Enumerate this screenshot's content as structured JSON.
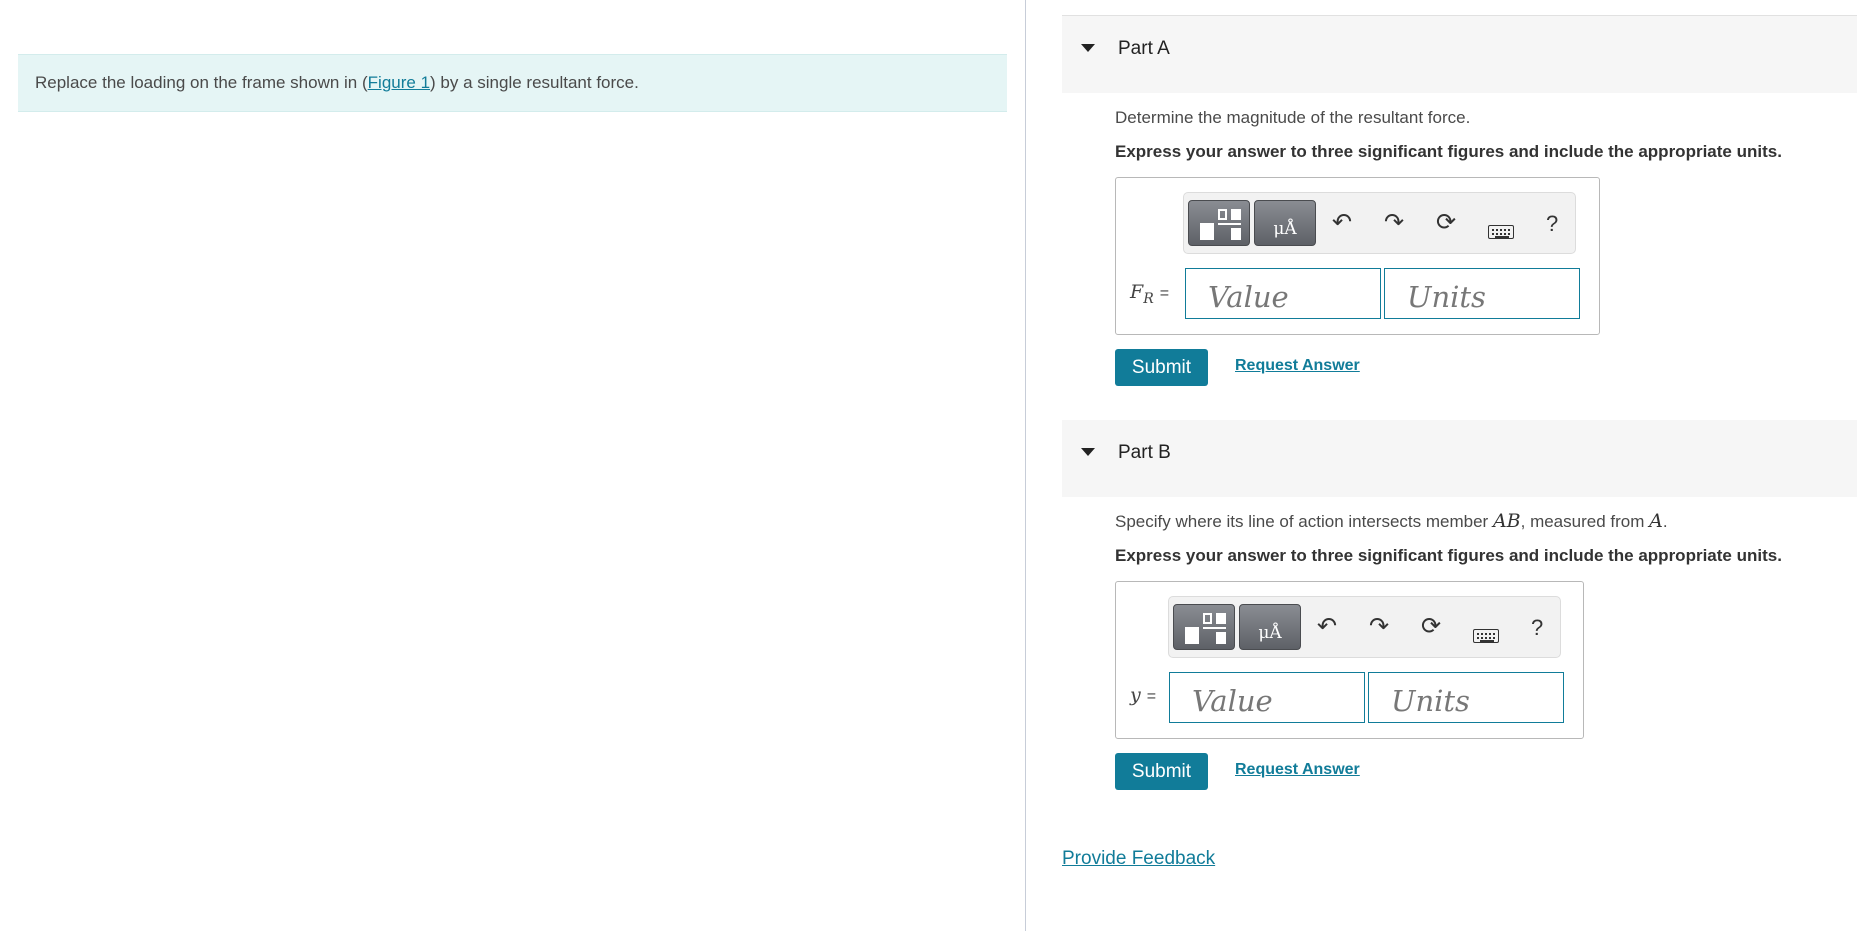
{
  "intro": {
    "prefix": "Replace the loading on the frame shown in (",
    "figure_link": "Figure 1",
    "suffix": ") by a single resultant force."
  },
  "parts": [
    {
      "title": "Part A",
      "prompt": "Determine the magnitude of the resultant force.",
      "instruction": "Express your answer to three significant figures and include the appropriate units.",
      "variable": "F",
      "variable_sub": "R",
      "equals": "=",
      "value_placeholder": "Value",
      "units_placeholder": "Units",
      "submit_label": "Submit",
      "request_answer_label": "Request Answer"
    },
    {
      "title": "Part B",
      "prompt_prefix": "Specify where its line of action intersects member ",
      "prompt_math1": "AB",
      "prompt_mid": ", measured from ",
      "prompt_math2": "A",
      "prompt_suffix": ".",
      "instruction": "Express your answer to three significant figures and include the appropriate units.",
      "variable": "y",
      "equals": "=",
      "value_placeholder": "Value",
      "units_placeholder": "Units",
      "submit_label": "Submit",
      "request_answer_label": "Request Answer"
    }
  ],
  "toolbar": {
    "units_glyph": "μÅ",
    "help_label": "?",
    "icons": [
      "templates-icon",
      "units-icon",
      "undo-icon",
      "redo-icon",
      "reset-icon",
      "keyboard-icon",
      "help-icon"
    ]
  },
  "feedback_label": "Provide Feedback",
  "colors": {
    "accent": "#117c99",
    "intro_bg": "#e5f5f5",
    "part_header_bg": "#f6f6f6"
  }
}
